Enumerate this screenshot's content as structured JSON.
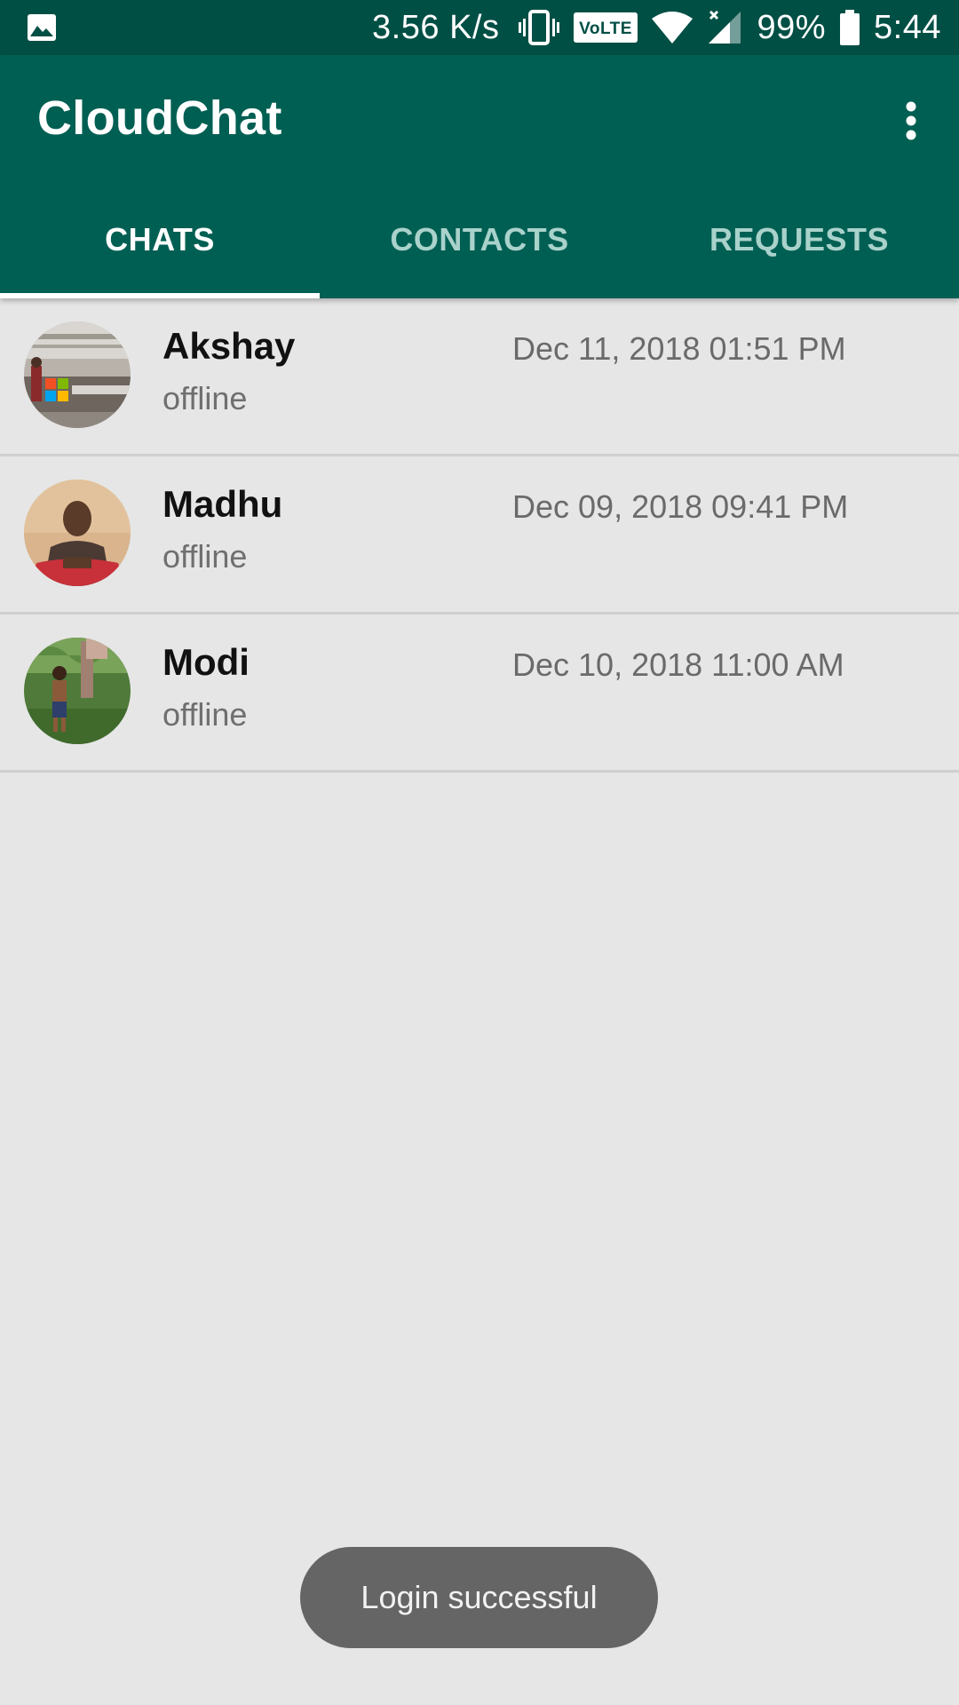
{
  "status_bar": {
    "net_speed": "3.56 K/s",
    "volte_label": "VoLTE",
    "battery": "99%",
    "time": "5:44",
    "icons": [
      "gallery-icon",
      "vibrate-icon",
      "volte-icon",
      "wifi-icon",
      "signal-icon",
      "battery-icon"
    ]
  },
  "app_bar": {
    "title": "CloudChat",
    "menu_icon": "more-vert-icon"
  },
  "tabs": [
    {
      "label": "CHATS",
      "active": true
    },
    {
      "label": "CONTACTS",
      "active": false
    },
    {
      "label": "REQUESTS",
      "active": false
    }
  ],
  "chats": [
    {
      "name": "Akshay",
      "status": "offline",
      "time": "Dec 11, 2018 01:51 PM"
    },
    {
      "name": "Madhu",
      "status": "offline",
      "time": "Dec 09, 2018 09:41 PM"
    },
    {
      "name": "Modi",
      "status": "offline",
      "time": "Dec 10, 2018 11:00 AM"
    }
  ],
  "toast": {
    "message": "Login successful"
  },
  "colors": {
    "status_bar": "#004f45",
    "app_bar": "#005f53",
    "background": "#e6e6e6",
    "tab_inactive": "#a9d2cb",
    "toast": "#656565"
  }
}
